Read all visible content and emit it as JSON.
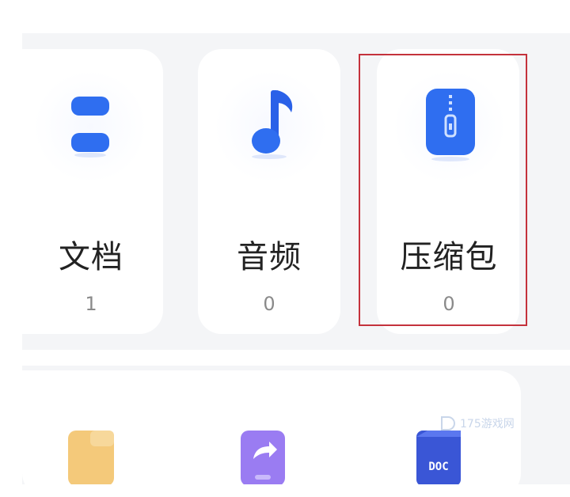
{
  "categories": [
    {
      "label": "文档",
      "count": "1",
      "icon": "document-icon"
    },
    {
      "label": "音频",
      "count": "0",
      "icon": "music-note-icon"
    },
    {
      "label": "压缩包",
      "count": "0",
      "icon": "zip-archive-icon"
    }
  ],
  "bottom_icons": [
    {
      "icon": "folder-icon"
    },
    {
      "icon": "share-arrow-icon"
    },
    {
      "icon": "doc-file-icon",
      "text": "DOC"
    }
  ],
  "watermark": {
    "text": "175游戏网"
  },
  "colors": {
    "accent_blue": "#2f6ef0",
    "highlight_red": "#c4323c",
    "background_gray": "#f4f5f7"
  }
}
